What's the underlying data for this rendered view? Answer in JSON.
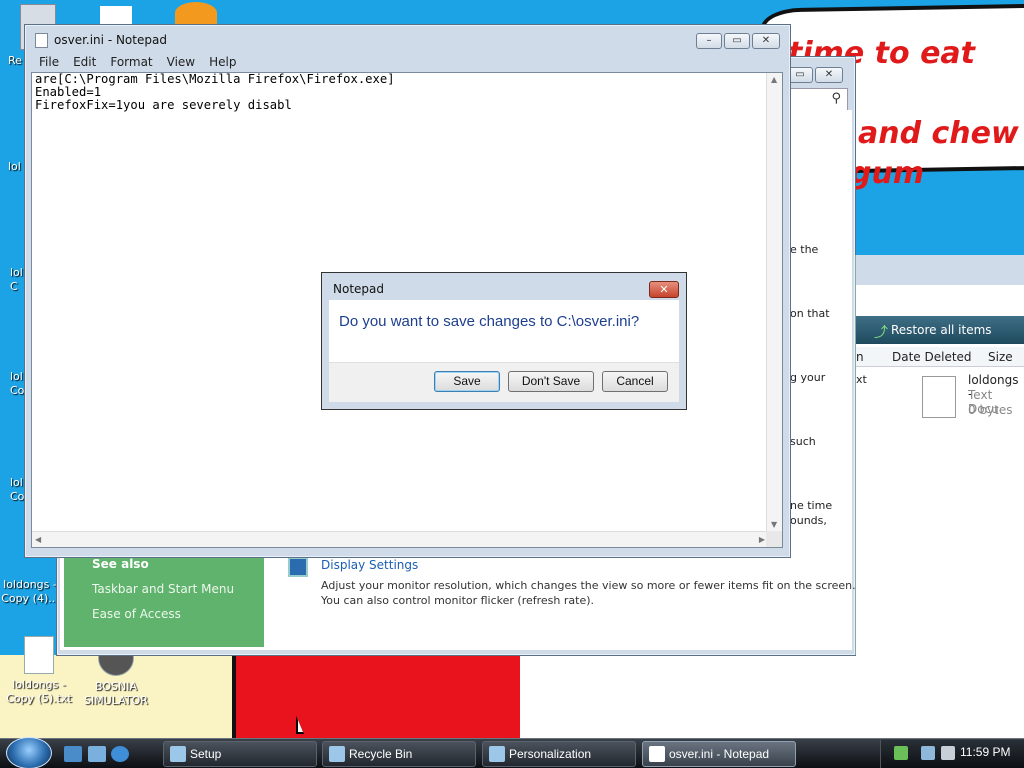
{
  "wallpaper": {
    "bubble_lines": [
      "time to eat shit",
      "and chew",
      "gum"
    ]
  },
  "desktop_icons": [
    {
      "label": "loldongs - Copy (4)..."
    },
    {
      "label": "loldongs - Copy (5).txt"
    },
    {
      "label": "BOSNIA SIMULATOR"
    }
  ],
  "desktop_fragments": [
    "Re",
    "lol",
    "lol C",
    "lol Co",
    "lol Co"
  ],
  "control_panel": {
    "see_also": "See also",
    "links": [
      "Taskbar and Start Menu",
      "Ease of Access"
    ],
    "display_settings_title": "Display Settings",
    "display_settings_desc_1": "Adjust your monitor resolution, which changes the view so more or fewer items fit on the screen.",
    "display_settings_desc_2": "You can also control monitor flicker (refresh rate).",
    "right_fragments": [
      "e the",
      "on that",
      "g your",
      "such",
      "ne time",
      "ounds,"
    ]
  },
  "recycle_bin": {
    "restore_label": "Restore all items",
    "columns": [
      "n",
      "Date Deleted",
      "Size"
    ],
    "left_fragment": "xt",
    "file": {
      "name": "loldongs -",
      "type": "Text Docu",
      "size": "0 bytes"
    }
  },
  "notepad": {
    "title": "osver.ini - Notepad",
    "menu": [
      "File",
      "Edit",
      "Format",
      "View",
      "Help"
    ],
    "content": "are[C:\\Program Files\\Mozilla Firefox\\Firefox.exe]\nEnabled=1\nFirefoxFix=1you are severely disabl"
  },
  "dialog": {
    "title": "Notepad",
    "message": "Do you want to save changes to C:\\osver.ini?",
    "buttons": {
      "save": "Save",
      "dont_save": "Don't Save",
      "cancel": "Cancel"
    }
  },
  "taskbar": {
    "buttons": [
      {
        "label": "Setup",
        "active": false
      },
      {
        "label": "Recycle Bin",
        "active": false
      },
      {
        "label": "Personalization",
        "active": false
      },
      {
        "label": "osver.ini - Notepad",
        "active": true
      }
    ],
    "clock": "11:59 PM"
  },
  "colors": {
    "desktop": "#1ba3e6",
    "dialog_message": "#1d3f8f",
    "bubble_text": "#e01a1a"
  }
}
